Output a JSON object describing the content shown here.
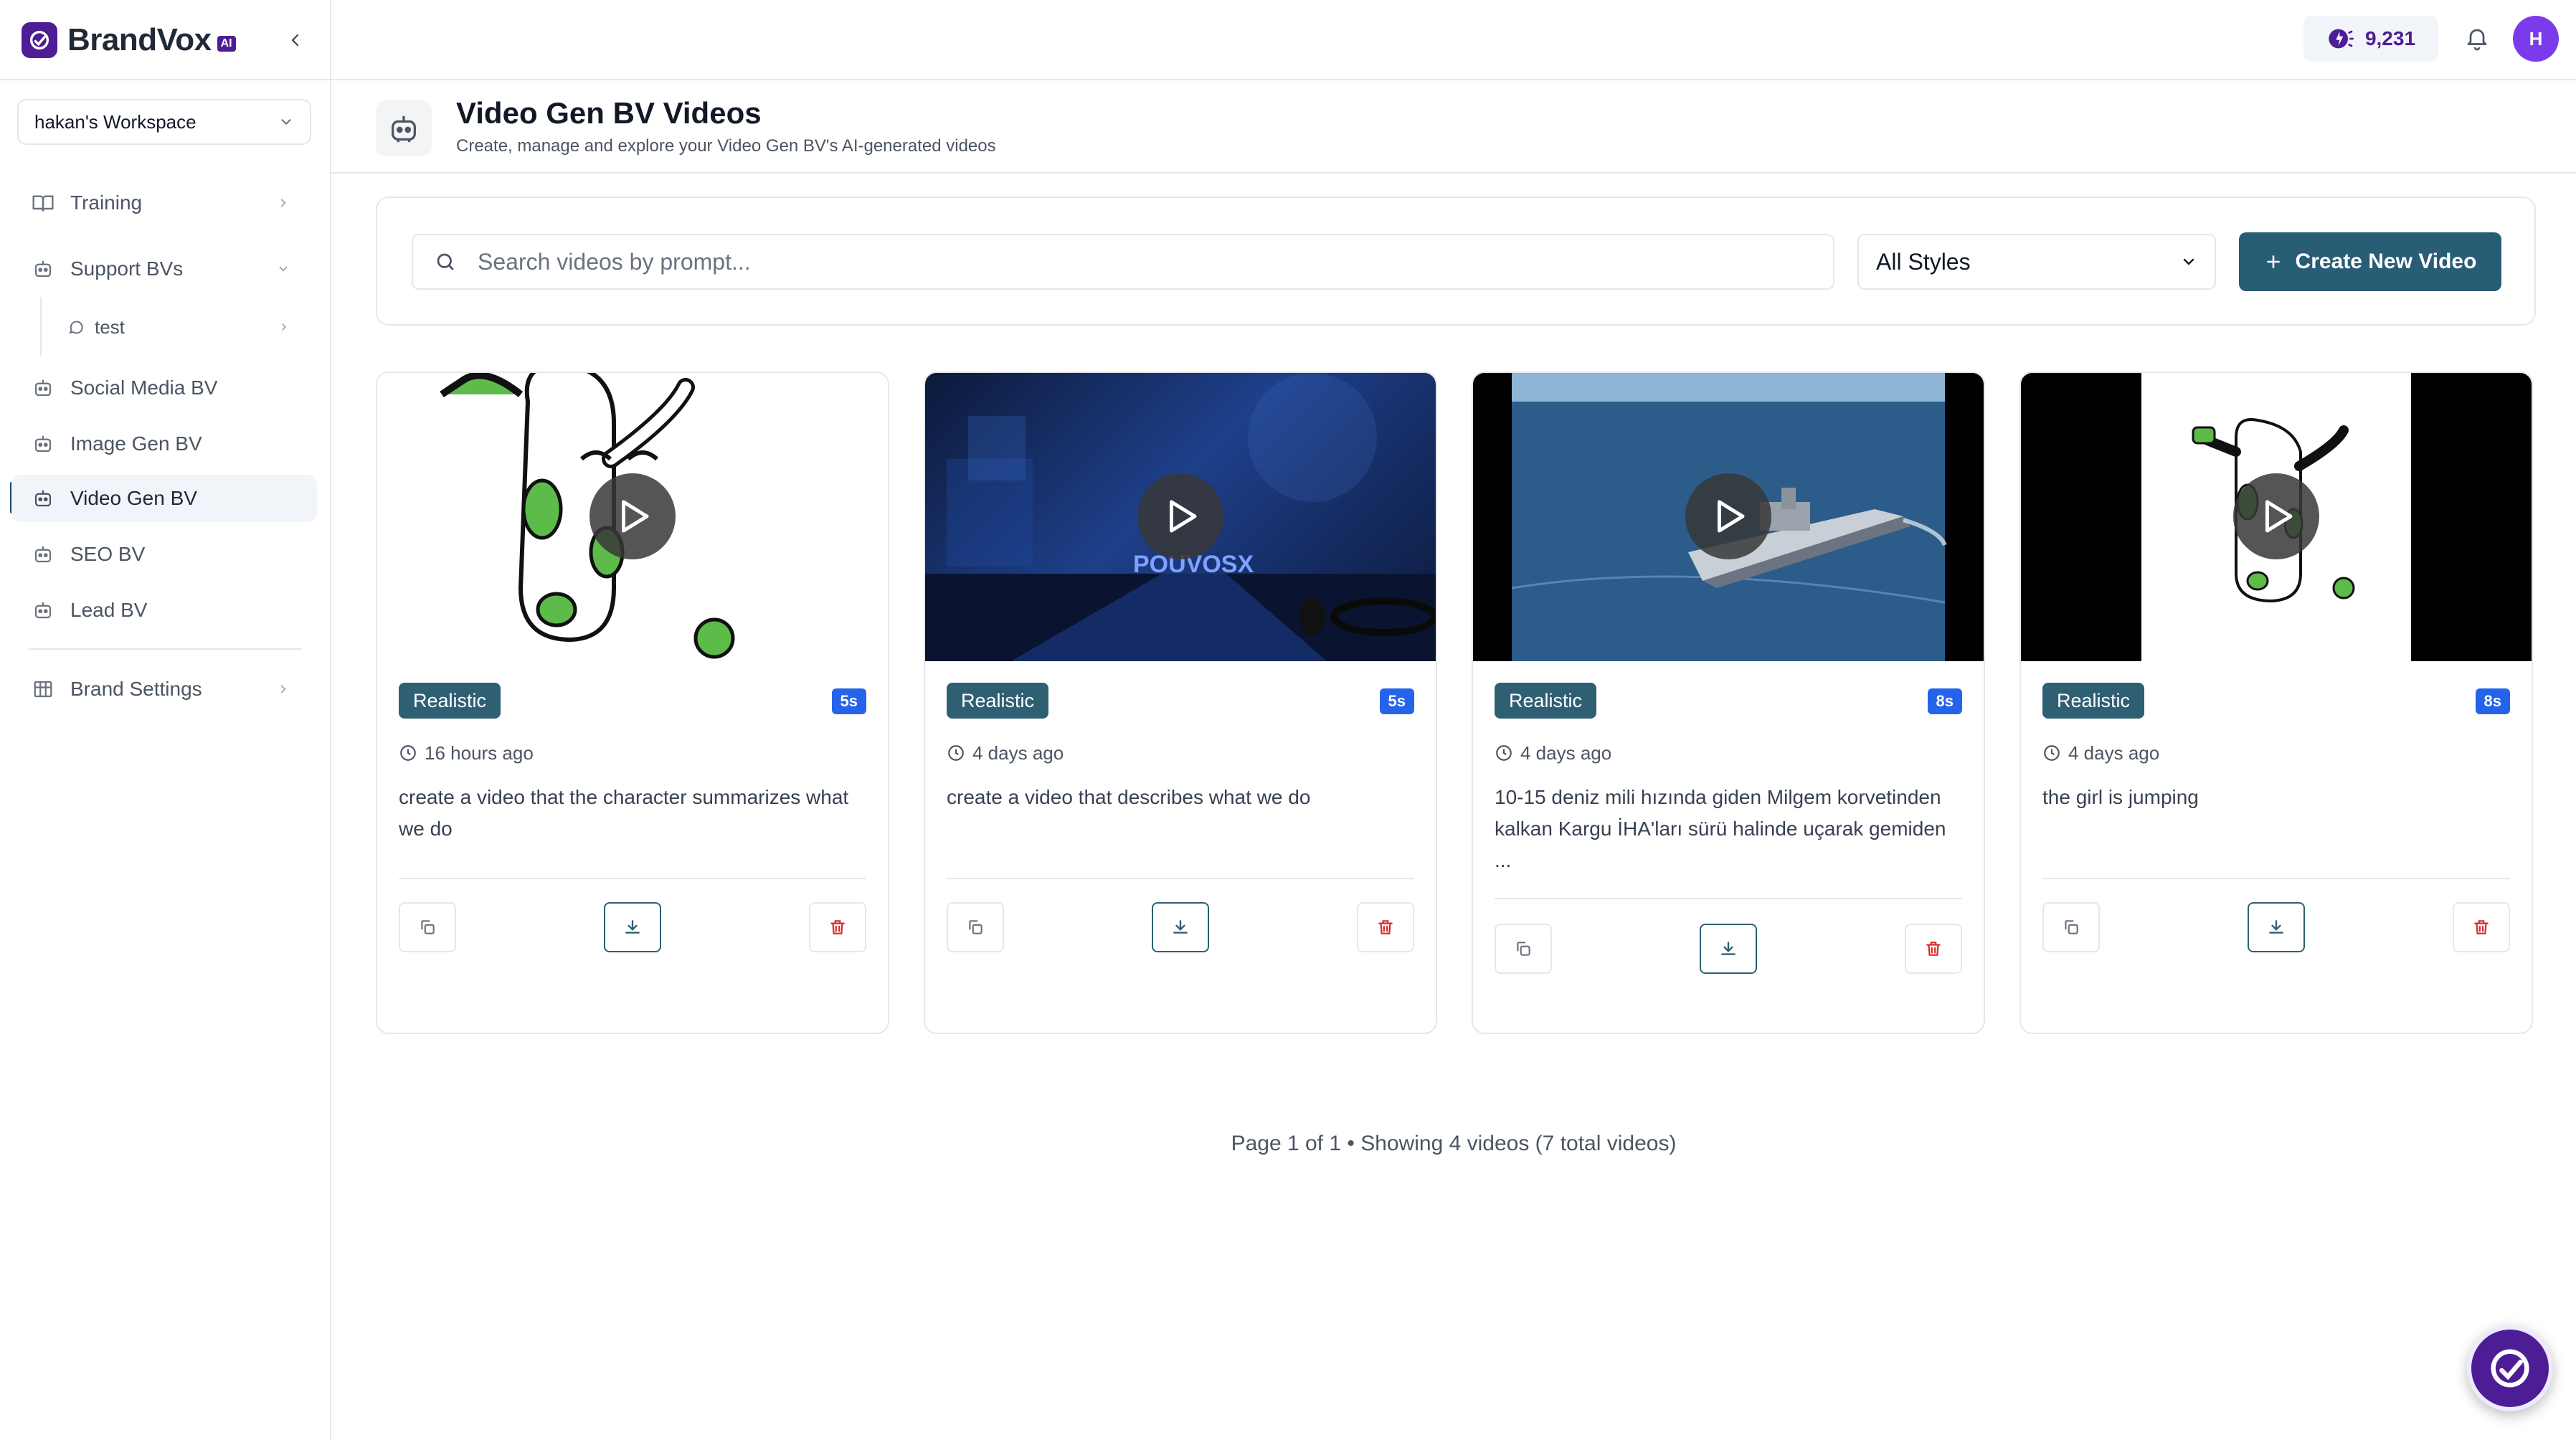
{
  "brand": {
    "name": "BrandVox",
    "badge": "AI"
  },
  "workspace": {
    "label": "hakan's Workspace"
  },
  "sidebar": {
    "items": [
      {
        "label": "Training"
      },
      {
        "label": "Support BVs"
      },
      {
        "label": "test"
      },
      {
        "label": "Social Media BV"
      },
      {
        "label": "Image Gen BV"
      },
      {
        "label": "Video Gen BV"
      },
      {
        "label": "SEO BV"
      },
      {
        "label": "Lead BV"
      },
      {
        "label": "Brand Settings"
      }
    ]
  },
  "topbar": {
    "credits": "9,231",
    "avatar_initial": "H"
  },
  "header": {
    "title": "Video Gen BV Videos",
    "subtitle": "Create, manage and explore your Video Gen BV's AI-generated videos"
  },
  "filters": {
    "search_placeholder": "Search videos by prompt...",
    "style_selected": "All Styles",
    "create_label": "Create New Video"
  },
  "cards": [
    {
      "style": "Realistic",
      "duration": "5s",
      "time": "16 hours ago",
      "prompt": "create a video that the character summarizes what we do"
    },
    {
      "style": "Realistic",
      "duration": "5s",
      "time": "4 days ago",
      "prompt": "create a video that describes what we do",
      "thumb_text": "POUVOSX"
    },
    {
      "style": "Realistic",
      "duration": "8s",
      "time": "4 days ago",
      "prompt": "10-15 deniz mili hızında giden Milgem korvetinden kalkan Kargu İHA'ları sürü halinde uçarak gemiden ..."
    },
    {
      "style": "Realistic",
      "duration": "8s",
      "time": "4 days ago",
      "prompt": "the girl is jumping"
    }
  ],
  "pagination": {
    "text": "Page 1 of 1 • Showing 4 videos (7 total videos)"
  },
  "colors": {
    "primary": "#275d75",
    "brand": "#4c1d95",
    "duration_badge": "#2563eb",
    "delete": "#dc2626"
  }
}
